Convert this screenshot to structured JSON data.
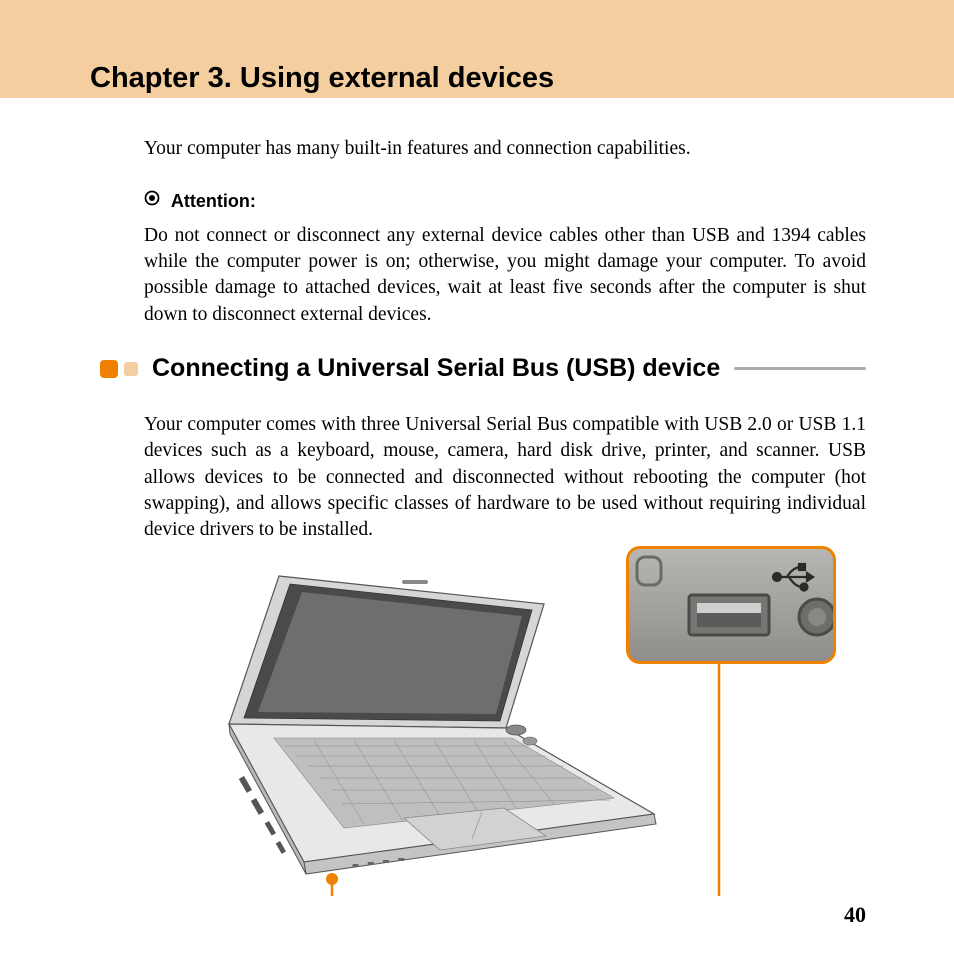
{
  "chapter": {
    "title": "Chapter 3. Using external devices"
  },
  "intro": "Your computer has many built-in features and connection capabilities.",
  "attention": {
    "label": "Attention:",
    "text": "Do not connect or disconnect any external device cables other than USB and 1394 cables while the computer power is on; otherwise, you might damage your computer. To avoid possible damage to attached devices, wait at least five seconds after the computer is shut down to disconnect external devices."
  },
  "section": {
    "title": "Connecting a Universal Serial Bus (USB) device",
    "text": "Your computer comes with three Universal Serial Bus compatible with USB 2.0 or USB 1.1 devices such as a keyboard, mouse, camera, hard disk drive, printer, and scanner. USB allows devices to be connected and disconnected without rebooting the computer (hot swapping), and allows specific classes of hardware to be used without requiring individual device drivers to be installed."
  },
  "page_number": "40"
}
